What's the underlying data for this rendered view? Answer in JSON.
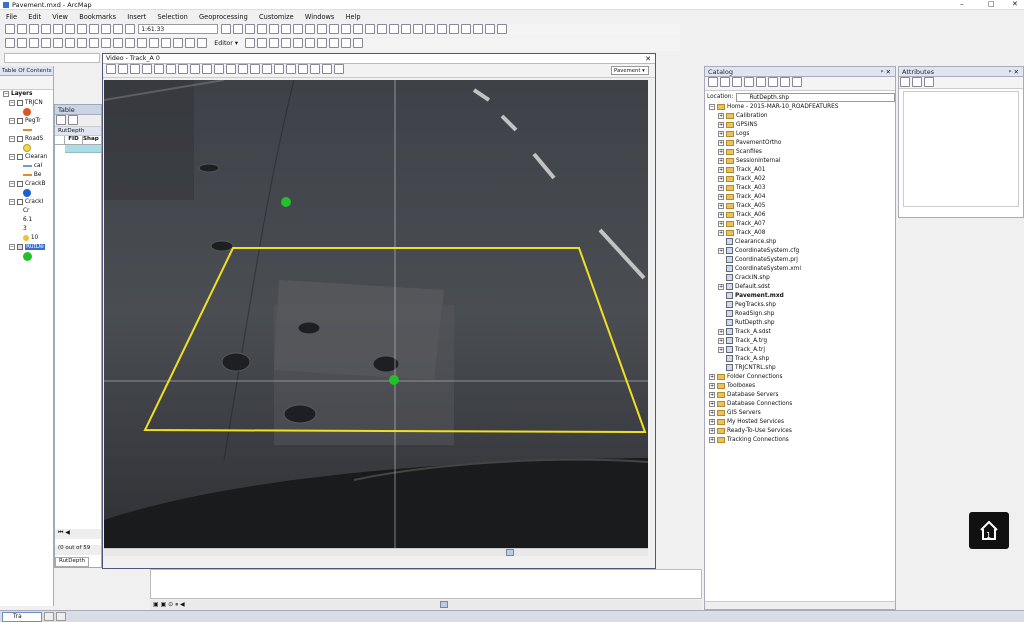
{
  "app": {
    "title": "Pavement.mxd - ArcMap",
    "window_controls": [
      "–",
      "□",
      "✕"
    ]
  },
  "menu": [
    "File",
    "Edit",
    "View",
    "Bookmarks",
    "Insert",
    "Selection",
    "Geoprocessing",
    "Customize",
    "Windows",
    "Help"
  ],
  "toolbar": {
    "scale": "1:61.33",
    "editor": "Editor ▾"
  },
  "toc": {
    "title": "Table Of Contents",
    "root": "Layers",
    "items": [
      {
        "label": "TRJCN",
        "symbol": "#e0541e",
        "symshape": "circle"
      },
      {
        "label": "PegTr",
        "symbol": "#e88a2a",
        "symshape": "line"
      },
      {
        "label": "RoadS",
        "symbol": "#f0d84c",
        "symshape": "circle"
      },
      {
        "label": "Clearan",
        "sub": [
          "cal",
          "Be"
        ],
        "symbol": "#6aa0c8",
        "symshape": "line"
      },
      {
        "label": "CrackB",
        "symbol": "#1d5fd1",
        "symshape": "circle"
      },
      {
        "label": "CrackI",
        "sub": [
          "Cr",
          "6.1",
          "3",
          "10"
        ],
        "symbol": "#f0c030",
        "symshape": "circle"
      },
      {
        "label": "RutDe",
        "symbol": "#22c02a",
        "symshape": "circle",
        "selected": true
      }
    ]
  },
  "table": {
    "title": "Table",
    "tab": "RutDepth",
    "columns": [
      "FID",
      "Shap"
    ],
    "status": "(0 out of 59",
    "tab_bottom": "RutDepth"
  },
  "video": {
    "title": "Video - Track_A 0",
    "dropdown": "Pavement ▾"
  },
  "catalog": {
    "title": "Catalog",
    "location_label": "Location:",
    "location": "RutDepth.shp",
    "items": [
      {
        "label": "Home - 2015-MAR-10_ROADFEATURES",
        "type": "folder",
        "level": 0,
        "exp": "−"
      },
      {
        "label": "Calibration",
        "type": "folder",
        "level": 1,
        "exp": "+"
      },
      {
        "label": "GPSINS",
        "type": "folder",
        "level": 1,
        "exp": "+"
      },
      {
        "label": "Logs",
        "type": "folder",
        "level": 1,
        "exp": "+"
      },
      {
        "label": "PavementOrtho",
        "type": "folder",
        "level": 1,
        "exp": "+"
      },
      {
        "label": "Scanfiles",
        "type": "folder",
        "level": 1,
        "exp": "+"
      },
      {
        "label": "SessionInternal",
        "type": "folder",
        "level": 1,
        "exp": "+"
      },
      {
        "label": "Track_A01",
        "type": "folder",
        "level": 1,
        "exp": "+"
      },
      {
        "label": "Track_A02",
        "type": "folder",
        "level": 1,
        "exp": "+"
      },
      {
        "label": "Track_A03",
        "type": "folder",
        "level": 1,
        "exp": "+"
      },
      {
        "label": "Track_A04",
        "type": "folder",
        "level": 1,
        "exp": "+"
      },
      {
        "label": "Track_A05",
        "type": "folder",
        "level": 1,
        "exp": "+"
      },
      {
        "label": "Track_A06",
        "type": "folder",
        "level": 1,
        "exp": "+"
      },
      {
        "label": "Track_A07",
        "type": "folder",
        "level": 1,
        "exp": "+"
      },
      {
        "label": "Track_A08",
        "type": "folder",
        "level": 1,
        "exp": "+"
      },
      {
        "label": "Clearance.shp",
        "type": "file",
        "level": 1,
        "exp": ""
      },
      {
        "label": "CoordinateSystem.cfg",
        "type": "file",
        "level": 1,
        "exp": "+"
      },
      {
        "label": "CoordinateSystem.prj",
        "type": "file",
        "level": 1,
        "exp": ""
      },
      {
        "label": "CoordinateSystem.xml",
        "type": "file",
        "level": 1,
        "exp": ""
      },
      {
        "label": "CrackIN.shp",
        "type": "file",
        "level": 1,
        "exp": ""
      },
      {
        "label": "Default.sdst",
        "type": "file",
        "level": 1,
        "exp": "+"
      },
      {
        "label": "Pavement.mxd",
        "type": "file",
        "level": 1,
        "exp": "",
        "bold": true
      },
      {
        "label": "PegTracks.shp",
        "type": "file",
        "level": 1,
        "exp": ""
      },
      {
        "label": "RoadSign.shp",
        "type": "file",
        "level": 1,
        "exp": ""
      },
      {
        "label": "RutDepth.shp",
        "type": "file",
        "level": 1,
        "exp": ""
      },
      {
        "label": "Track_A.sdst",
        "type": "file",
        "level": 1,
        "exp": "+"
      },
      {
        "label": "Track_A.trg",
        "type": "file",
        "level": 1,
        "exp": "+"
      },
      {
        "label": "Track_A.trj",
        "type": "file",
        "level": 1,
        "exp": "+"
      },
      {
        "label": "Track_A.shp",
        "type": "file",
        "level": 1,
        "exp": ""
      },
      {
        "label": "TRJCNTRL.shp",
        "type": "file",
        "level": 1,
        "exp": ""
      },
      {
        "label": "Folder Connections",
        "type": "folder",
        "level": 0,
        "exp": "+"
      },
      {
        "label": "Toolboxes",
        "type": "folder",
        "level": 0,
        "exp": "+"
      },
      {
        "label": "Database Servers",
        "type": "folder",
        "level": 0,
        "exp": "+"
      },
      {
        "label": "Database Connections",
        "type": "folder",
        "level": 0,
        "exp": "+"
      },
      {
        "label": "GIS Servers",
        "type": "folder",
        "level": 0,
        "exp": "+"
      },
      {
        "label": "My Hosted Services",
        "type": "folder",
        "level": 0,
        "exp": "+"
      },
      {
        "label": "Ready-To-Use Services",
        "type": "folder",
        "level": 0,
        "exp": "+"
      },
      {
        "label": "Tracking Connections",
        "type": "folder",
        "level": 0,
        "exp": "+"
      }
    ]
  },
  "attributes": {
    "title": "Attributes"
  },
  "taskbar": {
    "item": "Tra"
  },
  "colors": {
    "highlight": "#f0e020",
    "marker": "#22c02a",
    "panel": "#dfe6f1"
  }
}
